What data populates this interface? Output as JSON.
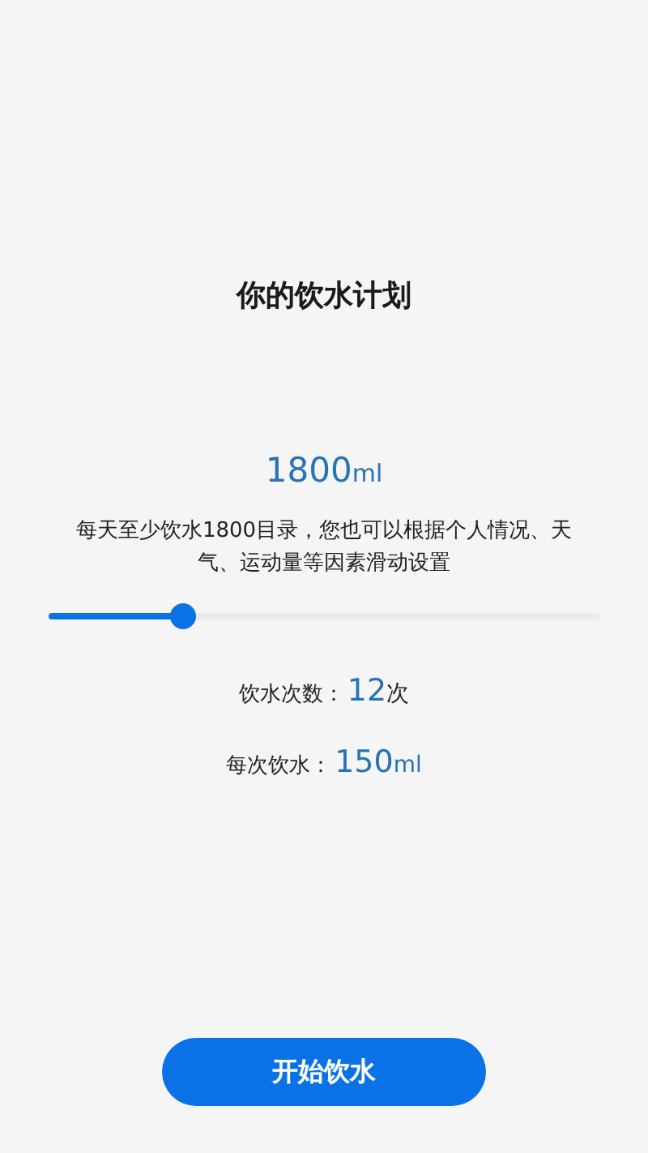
{
  "title": "你的饮水计划",
  "daily_amount": {
    "value": "1800",
    "unit": "ml"
  },
  "description": "每天至少饮水1800目录，您也可以根据个人情况、天气、运动量等因素滑动设置",
  "slider": {
    "level": 0.23
  },
  "stats": [
    {
      "label": "饮水次数：",
      "value": "12",
      "unit": "次"
    },
    {
      "label": "每次饮水：",
      "value": "150",
      "unit": "ml"
    }
  ],
  "start_button": {
    "label": "开始饮水"
  }
}
